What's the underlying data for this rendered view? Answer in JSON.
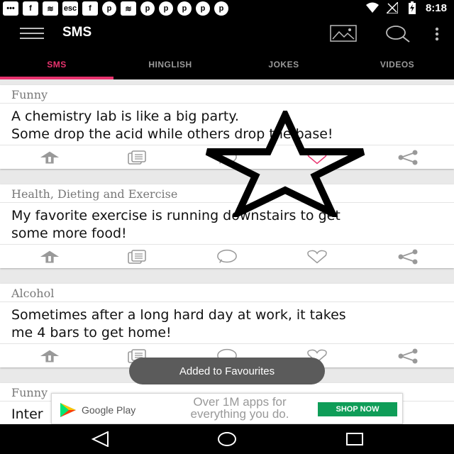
{
  "status_bar": {
    "time": "8:18",
    "icons": [
      {
        "name": "messenger-notif-icon",
        "glyph": "•••"
      },
      {
        "name": "facebook-notif-icon",
        "glyph": "f"
      },
      {
        "name": "cat-notif-icon",
        "glyph": "≋"
      },
      {
        "name": "esc-notif-icon",
        "glyph": "esc"
      },
      {
        "name": "facebook-notif-icon-2",
        "glyph": "f"
      },
      {
        "name": "pinterest-notif-icon",
        "glyph": "p"
      },
      {
        "name": "cat-notif-icon-2",
        "glyph": "≋"
      },
      {
        "name": "pinterest-notif-icon-2",
        "glyph": "p"
      },
      {
        "name": "pinterest-notif-icon-3",
        "glyph": "p"
      },
      {
        "name": "pinterest-notif-icon-4",
        "glyph": "p"
      },
      {
        "name": "pinterest-notif-icon-5",
        "glyph": "p"
      },
      {
        "name": "pinterest-notif-icon-6",
        "glyph": "p"
      }
    ]
  },
  "app_bar": {
    "title": "SMS",
    "icons": [
      "menu-icon",
      "image-icon",
      "search-icon",
      "overflow-menu-icon"
    ]
  },
  "tabs": [
    {
      "label": "SMS",
      "active": true
    },
    {
      "label": "HINGLISH",
      "active": false
    },
    {
      "label": "JOKES",
      "active": false
    },
    {
      "label": "VIDEOS",
      "active": false
    }
  ],
  "cards": [
    {
      "category": "Funny",
      "lines": [
        "A chemistry lab is like a big party.",
        "Some drop the acid while others drop the base!"
      ],
      "favourite": true
    },
    {
      "category": "Health, Dieting and Exercise",
      "lines": [
        "My favorite exercise is running downstairs to get",
        "some more food!"
      ],
      "favourite": false
    },
    {
      "category": "Alcohol",
      "lines": [
        "Sometimes after a long hard day at work, it takes",
        "me 4 bars to get home!"
      ],
      "favourite": false
    },
    {
      "category": "Funny",
      "lines": [
        "Inter",
        ""
      ],
      "favourite": false
    }
  ],
  "actions": [
    "upload-icon",
    "copy-icon",
    "whatsapp-icon",
    "heart-icon",
    "share-icon"
  ],
  "ad": {
    "brand": "Google Play",
    "text": "Over 1M apps for everything you do.",
    "button": "SHOP NOW"
  },
  "toast": "Added to Favourites",
  "colors": {
    "accent": "#e8336e",
    "toolbar": "#000000",
    "ad_button": "#0f9d58"
  }
}
